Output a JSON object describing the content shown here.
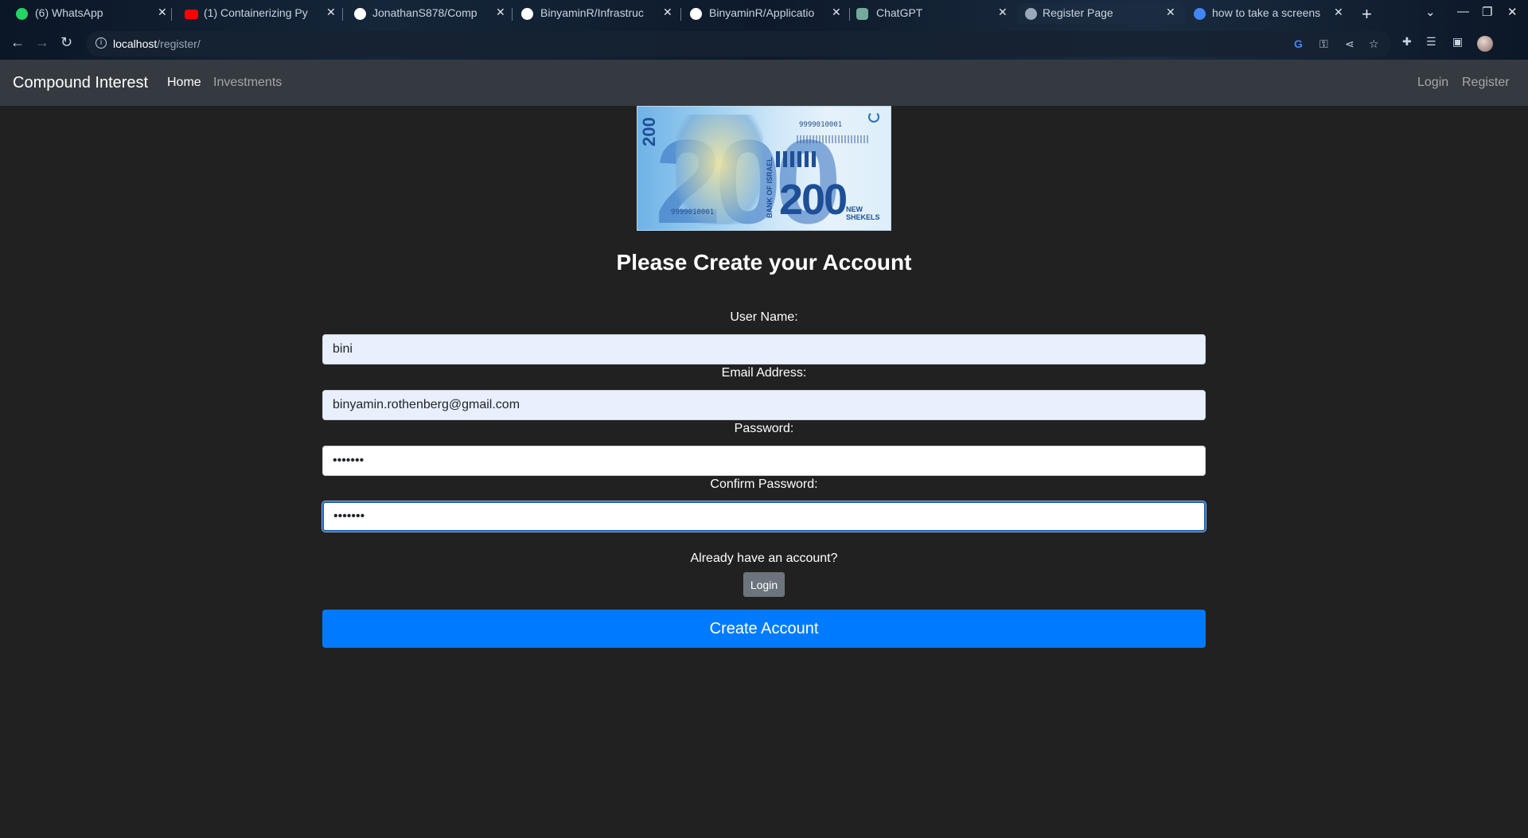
{
  "browser": {
    "tabs": [
      {
        "title": "(6) WhatsApp",
        "icon": "whatsapp-icon",
        "icon_color": "#25d366"
      },
      {
        "title": "(1) Containerizing Py",
        "icon": "youtube-icon",
        "icon_color": "#ff0000"
      },
      {
        "title": "JonathanS878/Comp",
        "icon": "github-icon",
        "icon_color": "#ffffff"
      },
      {
        "title": "BinyaminR/Infrastruc",
        "icon": "github-icon",
        "icon_color": "#ffffff"
      },
      {
        "title": "BinyaminR/Applicatio",
        "icon": "github-icon",
        "icon_color": "#ffffff"
      },
      {
        "title": "ChatGPT",
        "icon": "chatgpt-icon",
        "icon_color": "#74aa9c"
      },
      {
        "title": "Register Page",
        "icon": "globe-icon",
        "icon_color": "#9aa8bb",
        "active": true
      },
      {
        "title": "how to take a screens",
        "icon": "google-icon",
        "icon_color": "#4285f4"
      }
    ],
    "url_host": "localhost",
    "url_path": "/register/"
  },
  "navbar": {
    "brand": "Compound Interest",
    "links": [
      {
        "label": "Home",
        "active": true
      },
      {
        "label": "Investments",
        "active": false
      }
    ],
    "right_links": [
      {
        "label": "Login"
      },
      {
        "label": "Register"
      }
    ]
  },
  "banknote": {
    "denomination": "200",
    "serial": "9999010001",
    "bank": "BANK OF ISRAEL",
    "currency": "NEW SHEKELS"
  },
  "form": {
    "title": "Please Create your Account",
    "username_label": "User Name:",
    "username_value": "bini",
    "email_label": "Email Address:",
    "email_value": "binyamin.rothenberg@gmail.com",
    "password_label": "Password:",
    "password_value": "1234567",
    "confirm_label": "Confirm Password:",
    "confirm_value": "1234567",
    "already_text": "Already have an account?",
    "login_button": "Login",
    "submit_button": "Create Account"
  },
  "colors": {
    "page_bg": "#212121",
    "navbar_bg": "#343a40",
    "primary": "#007bff",
    "secondary": "#6c757d"
  }
}
